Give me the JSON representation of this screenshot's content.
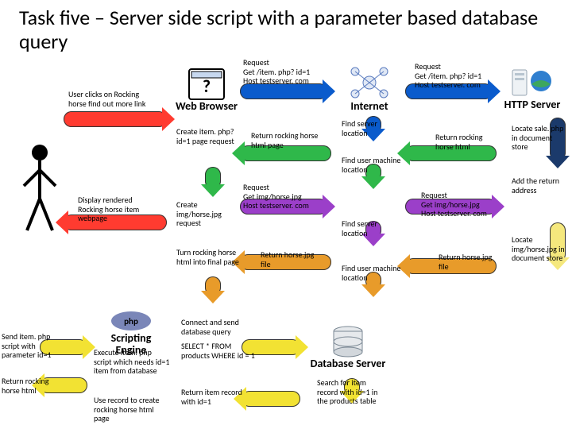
{
  "title": "Task five – Server side script with a parameter based database query",
  "nodes": {
    "user": "",
    "browser": "Web Browser",
    "internet": "Internet",
    "http": "HTTP Server",
    "db": "Database Server",
    "script": "Scripting Engine"
  },
  "ann": {
    "a1": "User clicks on Rocking horse find out more link",
    "a2": "Create item. php? id=1 page request",
    "a3": "Request\nGet /item. php? id=1\nHost testserver. com",
    "a4": "Find server location",
    "a5": "Request\nGet /item. php? id=1\nHost testserver. com",
    "a6": "Locate sale. php in document store",
    "a7": "Add the return address",
    "a8": "Return rocking horse html",
    "a9": "Find user machine location",
    "a10": "Return rocking horse html page",
    "a11": "Create img/horse.jpg request",
    "a12": "Request\nGet img/horse.jpg\nHost testserver. com",
    "a13": "Find server location",
    "a14": "Request\nGet img/horse.jpg\nHost testserver. com",
    "a15": "Locate img/horse.jpg in document store",
    "a16": "Return horse.jpg file",
    "a17": "Find user machine location",
    "a18": "Return horse.jpg file",
    "a19": "Turn rocking horse html into final page",
    "a20": "Display rendered Rocking horse item webpage",
    "a21": "Send item. php script with parameter id=1",
    "a22": "Execute item. php script which needs id=1 item from database",
    "a23": "Connect and send database query",
    "a24": "SELECT * FROM products WHERE id = 1",
    "a25": "Search for item record with id=1 in the products table",
    "a26": "Return item record with id=1",
    "a27": "Return rocking horse html",
    "a28": "Use record to create rocking horse html page"
  }
}
